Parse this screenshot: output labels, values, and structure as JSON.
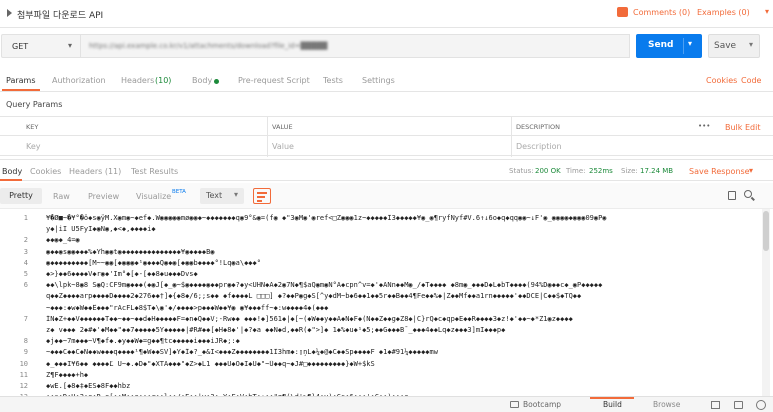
{
  "request": {
    "title": "첨부파일 다운로드 API",
    "comments_label": "Comments (0)",
    "examples_label": "Examples (0)",
    "method": "GET",
    "url": "https://api.example.co.kr/v1/attachments/download?file_id=█████",
    "send_label": "Send",
    "save_label": "Save"
  },
  "request_tabs": {
    "params": "Params",
    "authorization": "Authorization",
    "headers": "Headers",
    "headers_count": "(10)",
    "body": "Body",
    "prerequest": "Pre-request Script",
    "tests": "Tests",
    "settings": "Settings",
    "cookies": "Cookies",
    "code": "Code"
  },
  "query_params": {
    "title": "Query Params",
    "col_key": "KEY",
    "col_value": "VALUE",
    "col_description": "DESCRIPTION",
    "more": "•••",
    "bulk_edit": "Bulk Edit",
    "placeholder_key": "Key",
    "placeholder_value": "Value",
    "placeholder_description": "Description"
  },
  "response_tabs": {
    "body": "Body",
    "cookies": "Cookies",
    "headers": "Headers (11)",
    "test_results": "Test Results",
    "status_label": "Status:",
    "status_value": "200 OK",
    "time_label": "Time:",
    "time_value": "252ms",
    "size_label": "Size:",
    "size_value": "17.24 MB",
    "save_response": "Save Response"
  },
  "view_modes": {
    "pretty": "Pretty",
    "raw": "Raw",
    "preview": "Preview",
    "visualize": "Visualize",
    "beta": "BETA",
    "format": "Text"
  },
  "code_lines": [
    {
      "n": "1",
      "t": "¥�Ø■~�¥°�ö◆s◉ÿM.X◉m◉~◆ef◆.W◉◉◉◉◉mø◉◉◆~◆◆◆◆◆◆◆q◉9°&◉=(f◉ ◆\"3◉M◉'◉ref<□Z◉◉◉1z~◆◆◆◆◆Ï3◆◆◆◆◆¥◉_◉¶ryfNyf#V.6↑↓6o◆q◆qq◉◉~↓F'◉_◉◉◉◉◆◉◉◉09◉P◉"
    },
    {
      "n": "",
      "t": "y◆|iI   U5FyI◆◉N◉,◆<◆,◆◆◆◆i◆"
    },
    {
      "n": "2",
      "t": "◆◆◉◆_4=◉"
    },
    {
      "n": "3",
      "t": "◉◆◆◉s◉◉◆◆◆%◆Yh◉◉t◉◆◆◆◆◆◆◆◆◆◆◆◆◆◆¥◉◆◆◆◆B◉"
    },
    {
      "n": "4",
      "t": "◉◆◆◆◆◆◆◆◆◆[M~~◉◉[◆◉◉◉◆¹◉◆◆◆Q◉◆◉[◆◉◉b◆◆◆◆°!Lq◉a\\◆◆◆°"
    },
    {
      "n": "5",
      "t": "◆>}◆◆6◆◆◆◆V◆r◉◆'Im°◆[◆-[◆◆8◆u◆◆◆Dvs◆"
    },
    {
      "n": "6",
      "t": "◆◆\\lpk~8◉8  S◉Q:CF9m◉◆◆◆(◆◉J[◆_◉~$◉◆◆◆◆◉◆◆pr◉◆?◆y<UHN◆A◆2◉7N◆¶$aQ◉m◉N°A◆cpn^v=◆'◆ANn◆◆M◉_/◆T◆◆◆◆    ◆8m◉_◆◆◆D◆L◆bT◆◆◆◆(94%D◉◆◆c◆_◉P◆◆◆◆◆"
    },
    {
      "n": "",
      "t": "q◆◆Z◆◆◆◆arp◆◆◆◆D◆◆◆◆2◆276◆◆†]◆{◆8◆/6;;s◆◆    ◆f◆◆◆◆L □□□] ◆?◆◆P◉g◆S[^y◆dM~b◆6◆◆1◆◆5r◆◆B◆◆4¶Fe◆◆%◆|Z◆◆Mf◆◆a1rn◆◆◆◆◆'◆◆DCE|C◆◆$◆TQ◆◆"
    },
    {
      "n": "",
      "t": "~◆◆◆:◆w◆W◆◆Ê◆◆◆\"rAcFL◆8$T◆\\◉'◆/◆◆◆◆>p◆◆◆W◆◆¥◉ ◉¥◆◆◆ff~◆:w◆◆◆◆4◆(◆◆◆"
    },
    {
      "n": "7",
      "t": "ÎN◆Z+◆◆V◆◆◆◆◆◆T◆◆~◆◆~◆◆d◆H◆◆◆◆◆F=◆n◆Q◆◆V;-Rw◆◆   ◆◆◆!◆]561◆|◆[~(◆W◆◆y◆◆A◆N◆F◆(N◆◆Z◆◆g◆Z8◆|C}rQ◆c◆qp◆E◆◆R◆◆◆◆3◆z!◆'◆◆~◆*Z1◉z◆◆◆◆"
    },
    {
      "n": "",
      "t": "z◆ v◆◆◆ 2◆#◆'◆M◆◆\"◆◆7◆◆◆◆◆5Y◆◆◆◆◆|#R#◆◆[◆H◆8◆'|◆?◆a ◆◆N◆d,◆◆R(◆\">]◆ 1◆%◆u◆¹◆5;◆◆G◆◆◆B¯_◆◆◆4◆◆Lq◆z◆◆◆3]mI◆◆◆p◆"
    },
    {
      "n": "8",
      "t": "◆j◆◆~7m◆◆◆~V¶◆f◆.◆y◆◆W◆=g◆◆¶tc◆◆◆◆◆i◆◆◆iJR◆;:◆"
    },
    {
      "n": "9",
      "t": "~◆◆◆C◆◆C◆N◆◆w◆◆◆q◆◆◆◆¹¶◆W◆◆SV]◆Y◆Î◆?_◆&I<◆◆◆Z◆◆◆◆◆◆◆◆1Ï3hm◆:▯ņL◆¼◆@◆C◆◆Sp◆◆◆◆F ◆1◆#91¼◆◆◆◆◆mw"
    },
    {
      "n": "10",
      "t": "◆_◆◆◆I¥6◆◆  ◆◆◆◆Ľ  U~◆.◆D◆\"◆XTA◆◆◆\"◆Z>◆L1 ◆◆◆U◆O◆I◆U◆\"~Ü◆◆q~◆J#□◆◆◆◆◆◆◆◆◆}◆W+$kS"
    },
    {
      "n": "11",
      "t": "Z¶F◆◆◆◆+h◆"
    },
    {
      "n": "12",
      "t": "◆wE.[◆8◆‡◆ES◆8F◆◆hbz"
    },
    {
      "n": "13",
      "t": "◆◆◉◆D◆H◆2◆e◆R,e[◆◆M◆◆e◆◆◆r◆◆l◆◆/◆E◆◆|v◆3◆_Y◆F◆V◆bT◆:◆◆\"g¶(\\d'>¶}4◆v)◆Gs◆6◆◆◆'◆C◆◆)◆◆◆a"
    }
  ],
  "footer": {
    "bootcamp": "Bootcamp",
    "build": "Build",
    "browse": "Browse"
  },
  "colors": {
    "accent": "#f26b3a",
    "send": "#097bed",
    "status_ok": "#1c8a3a"
  }
}
